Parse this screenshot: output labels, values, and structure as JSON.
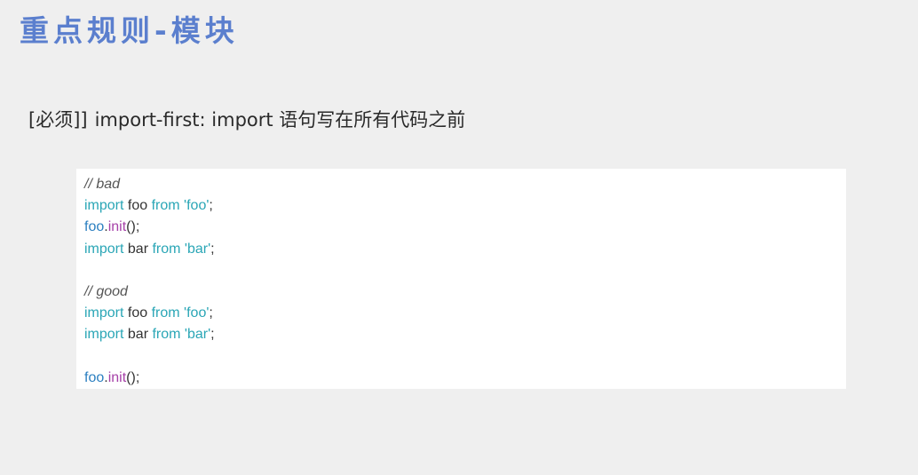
{
  "slide": {
    "title": "重点规则-模块"
  },
  "rule": {
    "tag": "[必须]]",
    "text": "import-first: import 语句写在所有代码之前"
  },
  "code": {
    "lines": [
      {
        "tokens": [
          {
            "t": "// bad",
            "k": "comment"
          }
        ]
      },
      {
        "tokens": [
          {
            "t": "import",
            "k": "keyword"
          },
          {
            "t": " foo ",
            "k": "ident"
          },
          {
            "t": "from",
            "k": "keyword"
          },
          {
            "t": " 'foo'",
            "k": "string"
          },
          {
            "t": ";",
            "k": "punct"
          }
        ]
      },
      {
        "tokens": [
          {
            "t": "foo",
            "k": "ident-blue"
          },
          {
            "t": ".",
            "k": "punct"
          },
          {
            "t": "init",
            "k": "method"
          },
          {
            "t": "();",
            "k": "punct"
          }
        ]
      },
      {
        "tokens": [
          {
            "t": "import",
            "k": "keyword"
          },
          {
            "t": " bar ",
            "k": "ident"
          },
          {
            "t": "from",
            "k": "keyword"
          },
          {
            "t": " 'bar'",
            "k": "string"
          },
          {
            "t": ";",
            "k": "punct"
          }
        ]
      },
      {
        "tokens": []
      },
      {
        "tokens": [
          {
            "t": "// good",
            "k": "comment"
          }
        ]
      },
      {
        "tokens": [
          {
            "t": "import",
            "k": "keyword"
          },
          {
            "t": " foo ",
            "k": "ident"
          },
          {
            "t": "from",
            "k": "keyword"
          },
          {
            "t": " 'foo'",
            "k": "string"
          },
          {
            "t": ";",
            "k": "punct"
          }
        ]
      },
      {
        "tokens": [
          {
            "t": "import",
            "k": "keyword"
          },
          {
            "t": " bar ",
            "k": "ident"
          },
          {
            "t": "from",
            "k": "keyword"
          },
          {
            "t": " 'bar'",
            "k": "string"
          },
          {
            "t": ";",
            "k": "punct"
          }
        ]
      },
      {
        "tokens": []
      },
      {
        "tokens": [
          {
            "t": "foo",
            "k": "ident-blue"
          },
          {
            "t": ".",
            "k": "punct"
          },
          {
            "t": "init",
            "k": "method"
          },
          {
            "t": "();",
            "k": "punct"
          }
        ]
      }
    ]
  },
  "colors": {
    "background": "#efefef",
    "title": "#5b7fce",
    "code_background": "#ffffff",
    "keyword": "#2aa6b6",
    "method": "#a640a8",
    "comment": "#555555"
  }
}
